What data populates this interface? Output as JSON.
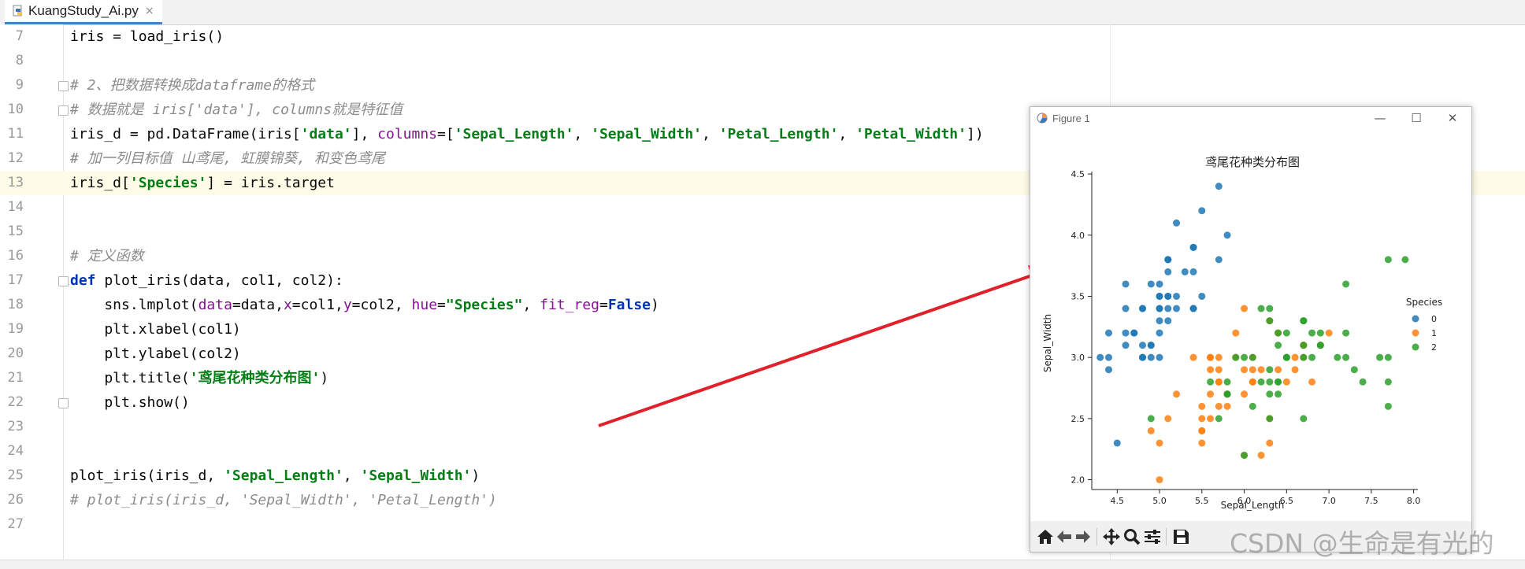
{
  "editor": {
    "tab_title": "KuangStudy_Ai.py",
    "close_symbol": "×",
    "current_line": 13,
    "lines": [
      {
        "n": "7",
        "spans": [
          [
            "plain",
            "iris = load_iris()"
          ]
        ]
      },
      {
        "n": "8",
        "spans": []
      },
      {
        "n": "9",
        "fold": true,
        "spans": [
          [
            "cm",
            "# 2、把数据转换成dataframe的格式"
          ]
        ]
      },
      {
        "n": "10",
        "fold": true,
        "spans": [
          [
            "cm",
            "# 数据就是 iris['data'], columns就是特征值"
          ]
        ]
      },
      {
        "n": "11",
        "spans": [
          [
            "plain",
            "iris_d = pd.DataFrame(iris["
          ],
          [
            "str",
            "'data'"
          ],
          [
            "plain",
            "], "
          ],
          [
            "par",
            "columns"
          ],
          [
            "plain",
            "=["
          ],
          [
            "str",
            "'Sepal_Length'"
          ],
          [
            "plain",
            ", "
          ],
          [
            "str",
            "'Sepal_Width'"
          ],
          [
            "plain",
            ", "
          ],
          [
            "str",
            "'Petal_Length'"
          ],
          [
            "plain",
            ", "
          ],
          [
            "str",
            "'Petal_Width'"
          ],
          [
            "plain",
            "])"
          ]
        ]
      },
      {
        "n": "12",
        "spans": [
          [
            "cm",
            "# 加一列目标值 山鸢尾, 虹膜锦葵, 和变色鸢尾"
          ]
        ]
      },
      {
        "n": "13",
        "spans": [
          [
            "plain",
            "iris_d["
          ],
          [
            "str",
            "'Species'"
          ],
          [
            "plain",
            "] = iris.target"
          ]
        ]
      },
      {
        "n": "14",
        "spans": []
      },
      {
        "n": "15",
        "spans": []
      },
      {
        "n": "16",
        "spans": [
          [
            "cm",
            "# 定义函数"
          ]
        ]
      },
      {
        "n": "17",
        "fold": true,
        "spans": [
          [
            "kw",
            "def"
          ],
          [
            "plain",
            " plot_iris(data, col1, col2):"
          ]
        ]
      },
      {
        "n": "18",
        "spans": [
          [
            "plain",
            "    sns.lmplot("
          ],
          [
            "par",
            "data"
          ],
          [
            "plain",
            "=data,"
          ],
          [
            "par",
            "x"
          ],
          [
            "plain",
            "=col1,"
          ],
          [
            "par",
            "y"
          ],
          [
            "plain",
            "=col2, "
          ],
          [
            "par",
            "hue"
          ],
          [
            "plain",
            "="
          ],
          [
            "str",
            "\"Species\""
          ],
          [
            "plain",
            ", "
          ],
          [
            "par",
            "fit_reg"
          ],
          [
            "plain",
            "="
          ],
          [
            "kw",
            "False"
          ],
          [
            "plain",
            ")"
          ]
        ]
      },
      {
        "n": "19",
        "spans": [
          [
            "plain",
            "    plt.xlabel(col1)"
          ]
        ]
      },
      {
        "n": "20",
        "spans": [
          [
            "plain",
            "    plt.ylabel(col2)"
          ]
        ]
      },
      {
        "n": "21",
        "spans": [
          [
            "plain",
            "    plt.title("
          ],
          [
            "str",
            "'鸢尾花种类分布图'"
          ],
          [
            "plain",
            ")"
          ]
        ]
      },
      {
        "n": "22",
        "fold": true,
        "spans": [
          [
            "plain",
            "    plt.show()"
          ]
        ]
      },
      {
        "n": "23",
        "spans": []
      },
      {
        "n": "24",
        "spans": []
      },
      {
        "n": "25",
        "spans": [
          [
            "plain",
            "plot_iris(iris_d, "
          ],
          [
            "str",
            "'Sepal_Length'"
          ],
          [
            "plain",
            ", "
          ],
          [
            "str",
            "'Sepal_Width'"
          ],
          [
            "plain",
            ")"
          ]
        ]
      },
      {
        "n": "26",
        "spans": [
          [
            "cm",
            "# plot_iris(iris_d, 'Sepal_Width', 'Petal_Length')"
          ]
        ]
      },
      {
        "n": "27",
        "spans": []
      }
    ]
  },
  "figure_window": {
    "title": "Figure 1",
    "minimize": "—",
    "maximize": "☐",
    "close": "✕",
    "toolbar_icons": [
      "home-icon",
      "back-arrow-icon",
      "forward-arrow-icon",
      "pan-icon",
      "zoom-icon",
      "configure-subplots-icon",
      "save-icon"
    ]
  },
  "annotation": {
    "arrow_color": "#e0202a"
  },
  "watermark": "CSDN @生命是有光的",
  "colors": {
    "species_0": "#1f77b4",
    "species_1": "#ff7f0e",
    "species_2": "#2ca02c"
  },
  "chart_data": {
    "type": "scatter",
    "title": "鸢尾花种类分布图",
    "xlabel": "Sepal_Length",
    "ylabel": "Sepal_Width",
    "xlim": [
      4.2,
      8.05
    ],
    "ylim": [
      1.92,
      4.52
    ],
    "xticks": [
      "4.5",
      "5.0",
      "5.5",
      "6.0",
      "6.5",
      "7.0",
      "7.5",
      "8.0"
    ],
    "yticks": [
      "2.0",
      "2.5",
      "3.0",
      "3.5",
      "4.0",
      "4.5"
    ],
    "legend": {
      "title": "Species",
      "placement": "right",
      "entries": [
        "0",
        "1",
        "2"
      ]
    },
    "series": [
      {
        "name": "0",
        "points": [
          [
            5.1,
            3.5
          ],
          [
            4.9,
            3.0
          ],
          [
            4.7,
            3.2
          ],
          [
            4.6,
            3.1
          ],
          [
            5.0,
            3.6
          ],
          [
            5.4,
            3.9
          ],
          [
            4.6,
            3.4
          ],
          [
            5.0,
            3.4
          ],
          [
            4.4,
            2.9
          ],
          [
            4.9,
            3.1
          ],
          [
            5.4,
            3.7
          ],
          [
            4.8,
            3.4
          ],
          [
            4.8,
            3.0
          ],
          [
            4.3,
            3.0
          ],
          [
            5.8,
            4.0
          ],
          [
            5.7,
            4.4
          ],
          [
            5.4,
            3.9
          ],
          [
            5.1,
            3.5
          ],
          [
            5.7,
            3.8
          ],
          [
            5.1,
            3.8
          ],
          [
            5.4,
            3.4
          ],
          [
            5.1,
            3.7
          ],
          [
            4.6,
            3.6
          ],
          [
            5.1,
            3.3
          ],
          [
            4.8,
            3.4
          ],
          [
            5.0,
            3.0
          ],
          [
            5.0,
            3.4
          ],
          [
            5.2,
            3.5
          ],
          [
            5.2,
            3.4
          ],
          [
            4.7,
            3.2
          ],
          [
            4.8,
            3.1
          ],
          [
            5.4,
            3.4
          ],
          [
            5.2,
            4.1
          ],
          [
            5.5,
            4.2
          ],
          [
            4.9,
            3.1
          ],
          [
            5.0,
            3.2
          ],
          [
            5.5,
            3.5
          ],
          [
            4.9,
            3.6
          ],
          [
            4.4,
            3.0
          ],
          [
            5.1,
            3.4
          ],
          [
            5.0,
            3.5
          ],
          [
            4.5,
            2.3
          ],
          [
            4.4,
            3.2
          ],
          [
            5.0,
            3.5
          ],
          [
            5.1,
            3.8
          ],
          [
            4.8,
            3.0
          ],
          [
            5.1,
            3.8
          ],
          [
            4.6,
            3.2
          ],
          [
            5.3,
            3.7
          ],
          [
            5.0,
            3.3
          ]
        ]
      },
      {
        "name": "1",
        "points": [
          [
            7.0,
            3.2
          ],
          [
            6.4,
            3.2
          ],
          [
            6.9,
            3.1
          ],
          [
            5.5,
            2.3
          ],
          [
            6.5,
            2.8
          ],
          [
            5.7,
            2.8
          ],
          [
            6.3,
            3.3
          ],
          [
            4.9,
            2.4
          ],
          [
            6.6,
            2.9
          ],
          [
            5.2,
            2.7
          ],
          [
            5.0,
            2.0
          ],
          [
            5.9,
            3.0
          ],
          [
            6.0,
            2.2
          ],
          [
            6.1,
            2.9
          ],
          [
            5.6,
            2.9
          ],
          [
            6.7,
            3.1
          ],
          [
            5.6,
            3.0
          ],
          [
            5.8,
            2.7
          ],
          [
            6.2,
            2.2
          ],
          [
            5.6,
            2.5
          ],
          [
            5.9,
            3.2
          ],
          [
            6.1,
            2.8
          ],
          [
            6.3,
            2.5
          ],
          [
            6.1,
            2.8
          ],
          [
            6.4,
            2.9
          ],
          [
            6.6,
            3.0
          ],
          [
            6.8,
            2.8
          ],
          [
            6.7,
            3.0
          ],
          [
            6.0,
            2.9
          ],
          [
            5.7,
            2.6
          ],
          [
            5.5,
            2.4
          ],
          [
            5.5,
            2.4
          ],
          [
            5.8,
            2.7
          ],
          [
            6.0,
            2.7
          ],
          [
            5.4,
            3.0
          ],
          [
            6.0,
            3.4
          ],
          [
            6.7,
            3.1
          ],
          [
            6.3,
            2.3
          ],
          [
            5.6,
            3.0
          ],
          [
            5.5,
            2.5
          ],
          [
            5.5,
            2.6
          ],
          [
            6.1,
            3.0
          ],
          [
            5.8,
            2.6
          ],
          [
            5.0,
            2.3
          ],
          [
            5.6,
            2.7
          ],
          [
            5.7,
            3.0
          ],
          [
            5.7,
            2.9
          ],
          [
            6.2,
            2.9
          ],
          [
            5.1,
            2.5
          ],
          [
            5.7,
            2.8
          ]
        ]
      },
      {
        "name": "2",
        "points": [
          [
            6.3,
            3.3
          ],
          [
            5.8,
            2.7
          ],
          [
            7.1,
            3.0
          ],
          [
            6.3,
            2.9
          ],
          [
            6.5,
            3.0
          ],
          [
            7.6,
            3.0
          ],
          [
            4.9,
            2.5
          ],
          [
            7.3,
            2.9
          ],
          [
            6.7,
            2.5
          ],
          [
            7.2,
            3.6
          ],
          [
            6.5,
            3.2
          ],
          [
            6.4,
            2.7
          ],
          [
            6.8,
            3.0
          ],
          [
            5.7,
            2.5
          ],
          [
            5.8,
            2.8
          ],
          [
            6.4,
            3.2
          ],
          [
            6.5,
            3.0
          ],
          [
            7.7,
            3.8
          ],
          [
            7.7,
            2.6
          ],
          [
            6.0,
            2.2
          ],
          [
            6.9,
            3.2
          ],
          [
            5.6,
            2.8
          ],
          [
            7.7,
            2.8
          ],
          [
            6.3,
            2.7
          ],
          [
            6.7,
            3.3
          ],
          [
            7.2,
            3.2
          ],
          [
            6.2,
            2.8
          ],
          [
            6.1,
            3.0
          ],
          [
            6.4,
            2.8
          ],
          [
            7.2,
            3.0
          ],
          [
            7.4,
            2.8
          ],
          [
            7.9,
            3.8
          ],
          [
            6.4,
            2.8
          ],
          [
            6.3,
            2.8
          ],
          [
            6.1,
            2.6
          ],
          [
            7.7,
            3.0
          ],
          [
            6.3,
            3.4
          ],
          [
            6.4,
            3.1
          ],
          [
            6.0,
            3.0
          ],
          [
            6.9,
            3.1
          ],
          [
            6.7,
            3.1
          ],
          [
            6.9,
            3.1
          ],
          [
            5.8,
            2.7
          ],
          [
            6.8,
            3.2
          ],
          [
            6.7,
            3.3
          ],
          [
            6.7,
            3.0
          ],
          [
            6.3,
            2.5
          ],
          [
            6.5,
            3.0
          ],
          [
            6.2,
            3.4
          ],
          [
            5.9,
            3.0
          ]
        ]
      }
    ]
  }
}
